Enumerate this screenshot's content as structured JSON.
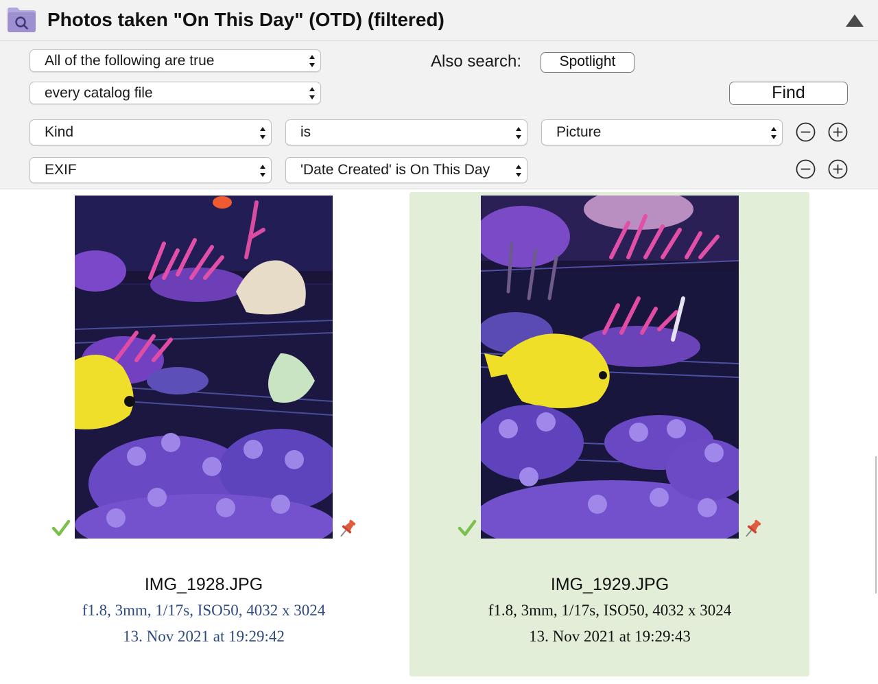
{
  "window": {
    "title": "Photos taken \"On This Day\" (OTD)  (filtered)"
  },
  "criteria": {
    "match_mode": "All of the following are true",
    "scope": "every catalog file",
    "also_search_label": "Also search:",
    "spotlight_label": "Spotlight",
    "find_label": "Find",
    "rows": [
      {
        "field": "Kind",
        "operator": "is",
        "value": "Picture"
      },
      {
        "field": "EXIF",
        "operator": "'Date Created' is On This Day"
      }
    ]
  },
  "results": [
    {
      "filename": "IMG_1928.JPG",
      "exif": "f1.8, 3mm, 1/17s, ISO50, 4032 x 3024",
      "date": "13. Nov 2021 at 19:29:42",
      "selected": false,
      "checked": true,
      "pinned": true
    },
    {
      "filename": "IMG_1929.JPG",
      "exif": "f1.8, 3mm, 1/17s, ISO50, 4032 x 3024",
      "date": "13. Nov 2021 at 19:29:43",
      "selected": true,
      "checked": true,
      "pinned": true
    }
  ],
  "colors": {
    "header_bg": "#f2f2f2",
    "selected_bg": "#e2eed8",
    "check": "#7cbf4f",
    "pin": "#e05a3e",
    "meta_blue": "#2e4a80",
    "folder": "#9e8fd0"
  },
  "icons": {
    "folder": "folder-search-icon",
    "collapse": "triangle-up-icon",
    "remove": "minus-circle-icon",
    "add": "plus-circle-icon",
    "check": "checkmark-icon",
    "pin": "pushpin-icon"
  }
}
